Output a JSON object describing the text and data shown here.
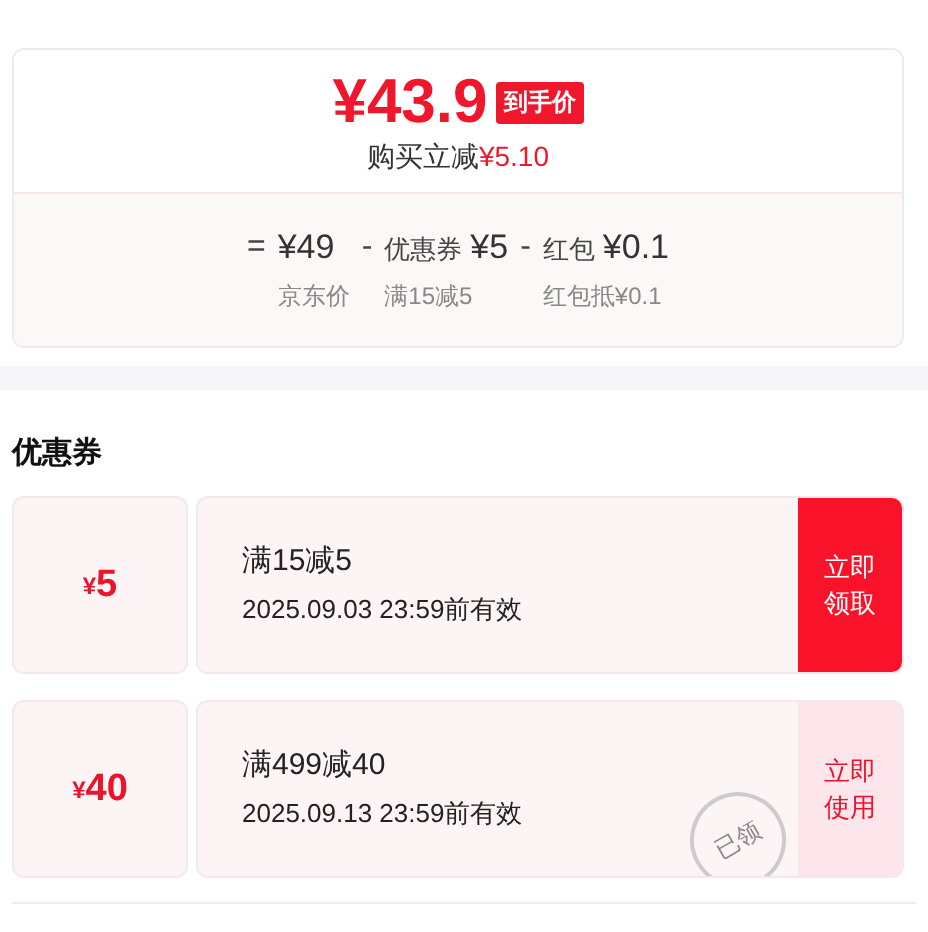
{
  "price_card": {
    "price": "¥43.9",
    "price_tag": "到手价",
    "saving_label": "购买立减",
    "saving_amount": "¥5.10",
    "terms": [
      {
        "operator": "=",
        "amount": "¥49",
        "caption": "京东价"
      },
      {
        "operator": "-",
        "label": "优惠券",
        "amount": "¥5",
        "caption": "满15减5"
      },
      {
        "operator": "-",
        "label": "红包",
        "amount": "¥0.1",
        "caption": "红包抵¥0.1"
      }
    ]
  },
  "coupons_section": {
    "title": "优惠券",
    "coupons": [
      {
        "currency": "¥",
        "amount": "5",
        "condition": "满15减5",
        "validity": "2025.09.03 23:59前有效",
        "action": "立即领取",
        "claimed": false
      },
      {
        "currency": "¥",
        "amount": "40",
        "condition": "满499减40",
        "validity": "2025.09.13 23:59前有效",
        "action": "立即使用",
        "claimed": true,
        "stamp": "已领"
      }
    ]
  }
}
